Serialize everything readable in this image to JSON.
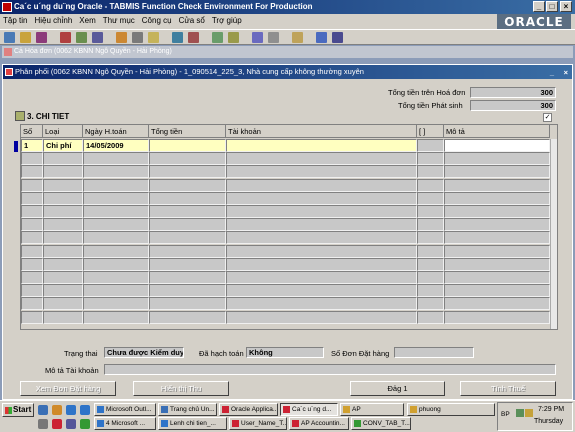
{
  "app": {
    "title": "Ca´c u´ng du¨ng Oracle - TABMIS Function Check Environment For Production",
    "logo": "ORACLE",
    "menu": [
      "Tập tin",
      "Hiệu chỉnh",
      "Xem",
      "Thư mục",
      "Công cụ",
      "Cửa sổ",
      "Trợ giúp"
    ]
  },
  "background_window": {
    "title": "Cả Hóa đơn (0062 KBNN Ngô Quyền - Hải Phòng)"
  },
  "window": {
    "title": "Phân phối (0062 KBNN Ngô Quyền - Hải Phòng) - 1_090514_225_3, Nhà cung cấp không thường xuyên"
  },
  "totals": {
    "invoice_label": "Tổng tiền trên Hoá đơn",
    "invoice_value": "300",
    "generated_label": "Tổng tiền Phát sinh",
    "generated_value": "300"
  },
  "section": {
    "title": "3. CHI TIET",
    "checkbox": "✓"
  },
  "grid": {
    "headers": [
      "Số",
      "Loại",
      "Ngày H.toán",
      "Tổng tiền",
      "Tài khoản",
      "[ ]",
      "Mô tả"
    ],
    "rows": [
      {
        "so": "1",
        "loai": "Chi phí",
        "ngay": "14/05/2009",
        "tong": "",
        "tk": "",
        "flag": "",
        "mota": ""
      }
    ]
  },
  "footer": {
    "status_label": "Trạng thai",
    "status_value": "Chưa được Kiểm duyệ",
    "accounted_label": "Đã hạch toán",
    "accounted_value": "Không",
    "po_label": "Số Đơn Đặt hàng",
    "po_value": "",
    "account_desc_label": "Mô tả Tài khoản",
    "account_desc_value": ""
  },
  "buttons": {
    "view_po": "Xem Đơn Đặt hàng",
    "show_all": "Hiển thị Thu",
    "dong1": "Đảg 1",
    "tinh_thue": "Tính Thuế"
  },
  "taskbar": {
    "start": "Start",
    "row1": [
      "Microsoft Outl...",
      "Trang chủ Un...",
      "Oracle Applica...",
      "Ca´c u´ng d...",
      "AP",
      "phuong"
    ],
    "row2": [
      "4 Microsoft ...",
      "Lenh chi tien_...",
      "User_Name_T...",
      "AP Accountin...",
      "CONV_TAB_T..."
    ],
    "lang": "BP",
    "time": "7:29 PM",
    "day": "Thursday"
  }
}
